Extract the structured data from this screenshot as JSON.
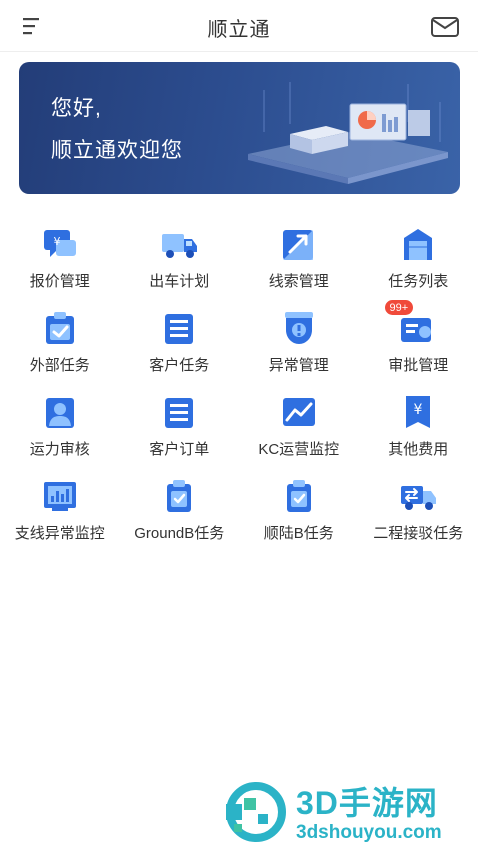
{
  "header": {
    "title": "顺立通",
    "menu_icon": "menu-icon",
    "mail_icon": "mail-icon"
  },
  "banner": {
    "line1": "您好,",
    "line2": "顺立通欢迎您"
  },
  "menu": {
    "items": [
      {
        "label": "报价管理",
        "icon": "quote-icon"
      },
      {
        "label": "出车计划",
        "icon": "truck-icon"
      },
      {
        "label": "线索管理",
        "icon": "trend-arrow-icon"
      },
      {
        "label": "任务列表",
        "icon": "task-list-icon"
      },
      {
        "label": "外部任务",
        "icon": "external-task-icon"
      },
      {
        "label": "客户任务",
        "icon": "customer-task-icon"
      },
      {
        "label": "异常管理",
        "icon": "exception-icon"
      },
      {
        "label": "审批管理",
        "icon": "approval-icon",
        "badge": "99+"
      },
      {
        "label": "运力审核",
        "icon": "capacity-review-icon"
      },
      {
        "label": "客户订单",
        "icon": "customer-order-icon"
      },
      {
        "label": "KC运营监控",
        "icon": "monitor-chart-icon"
      },
      {
        "label": "其他费用",
        "icon": "other-fee-icon"
      },
      {
        "label": "支线异常监控",
        "icon": "branch-monitor-icon"
      },
      {
        "label": "GroundB任务",
        "icon": "groundb-task-icon"
      },
      {
        "label": "顺陆B任务",
        "icon": "shunlu-task-icon"
      },
      {
        "label": "二程接驳任务",
        "icon": "transfer-truck-icon"
      }
    ]
  },
  "colors": {
    "icon_blue": "#2f6fe0",
    "icon_light": "#8fc2ff",
    "badge_red": "#f04a3a",
    "banner_dark": "#233d78"
  },
  "watermark": {
    "title": "3D手游网",
    "url": "3dshouyou.com"
  }
}
